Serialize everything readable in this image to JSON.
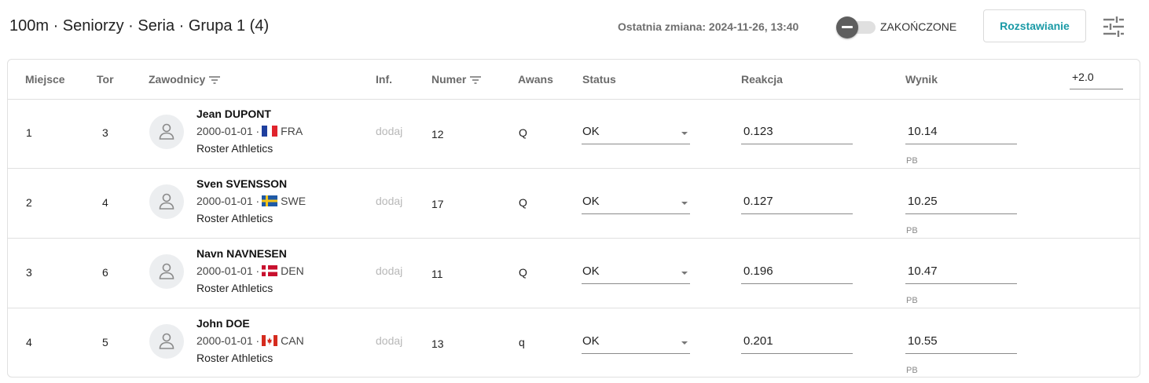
{
  "header": {
    "title": "100m · Seniorzy · Seria · Grupa 1 (4)",
    "last_change": "Ostatnia zmiana: 2024-11-26, 13:40",
    "toggle_label": "ZAKOŃCZONE",
    "toggle_state": "off",
    "arrange_button": "Rozstawianie",
    "settings_icon": "tune-icon",
    "accent_color": "#1a9aa6"
  },
  "table": {
    "columns": {
      "place": "Miejsce",
      "lane": "Tor",
      "athletes": "Zawodnicy",
      "info": "Inf.",
      "number": "Numer",
      "advance": "Awans",
      "status": "Status",
      "reaction": "Reakcja",
      "result": "Wynik"
    },
    "wind": "+2.0",
    "rows": [
      {
        "place": "1",
        "lane": "3",
        "name": "Jean DUPONT",
        "dob": "2000-01-01 ·",
        "country": "FRA",
        "club": "Roster Athletics",
        "info": "dodaj",
        "number": "12",
        "advance": "Q",
        "status": "OK",
        "reaction": "0.123",
        "result": "10.14",
        "record": "PB"
      },
      {
        "place": "2",
        "lane": "4",
        "name": "Sven SVENSSON",
        "dob": "2000-01-01 ·",
        "country": "SWE",
        "club": "Roster Athletics",
        "info": "dodaj",
        "number": "17",
        "advance": "Q",
        "status": "OK",
        "reaction": "0.127",
        "result": "10.25",
        "record": "PB"
      },
      {
        "place": "3",
        "lane": "6",
        "name": "Navn NAVNESEN",
        "dob": "2000-01-01 ·",
        "country": "DEN",
        "club": "Roster Athletics",
        "info": "dodaj",
        "number": "11",
        "advance": "Q",
        "status": "OK",
        "reaction": "0.196",
        "result": "10.47",
        "record": "PB"
      },
      {
        "place": "4",
        "lane": "5",
        "name": "John DOE",
        "dob": "2000-01-01 ·",
        "country": "CAN",
        "club": "Roster Athletics",
        "info": "dodaj",
        "number": "13",
        "advance": "q",
        "status": "OK",
        "reaction": "0.201",
        "result": "10.55",
        "record": "PB"
      }
    ]
  }
}
